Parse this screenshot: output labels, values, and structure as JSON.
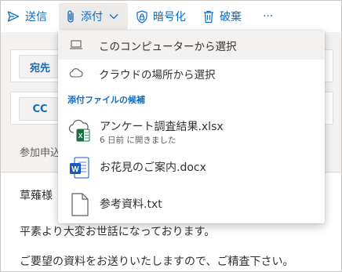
{
  "toolbar": {
    "send_label": "送信",
    "attach_label": "添付",
    "encrypt_label": "暗号化",
    "discard_label": "破棄",
    "more_label": "···"
  },
  "compose": {
    "to_label": "宛先",
    "cc_label": "CC",
    "subject_value": "参加申込",
    "body_lines": [
      "草薙様",
      "平素より大変お世話になっております。",
      "ご要望の資料をお送りいたしますので、ご精査下さい。"
    ]
  },
  "attach_menu": {
    "from_computer_label": "このコンピューターから選択",
    "from_cloud_label": "クラウドの場所から選択",
    "suggested_header": "添付ファイルの候補",
    "files": [
      {
        "name": "アンケート調査結果.xlsx",
        "meta": "6 日前 に開きました",
        "icon": "excel-cloud-icon"
      },
      {
        "name": "お花見のご案内.docx",
        "meta": "",
        "icon": "word-icon"
      },
      {
        "name": "参考資料.txt",
        "meta": "",
        "icon": "text-file-icon"
      }
    ]
  },
  "colors": {
    "accent": "#0f6cbd",
    "excel": "#1d6f42",
    "word": "#185abd",
    "menu_highlight": "#f3f2f1"
  }
}
